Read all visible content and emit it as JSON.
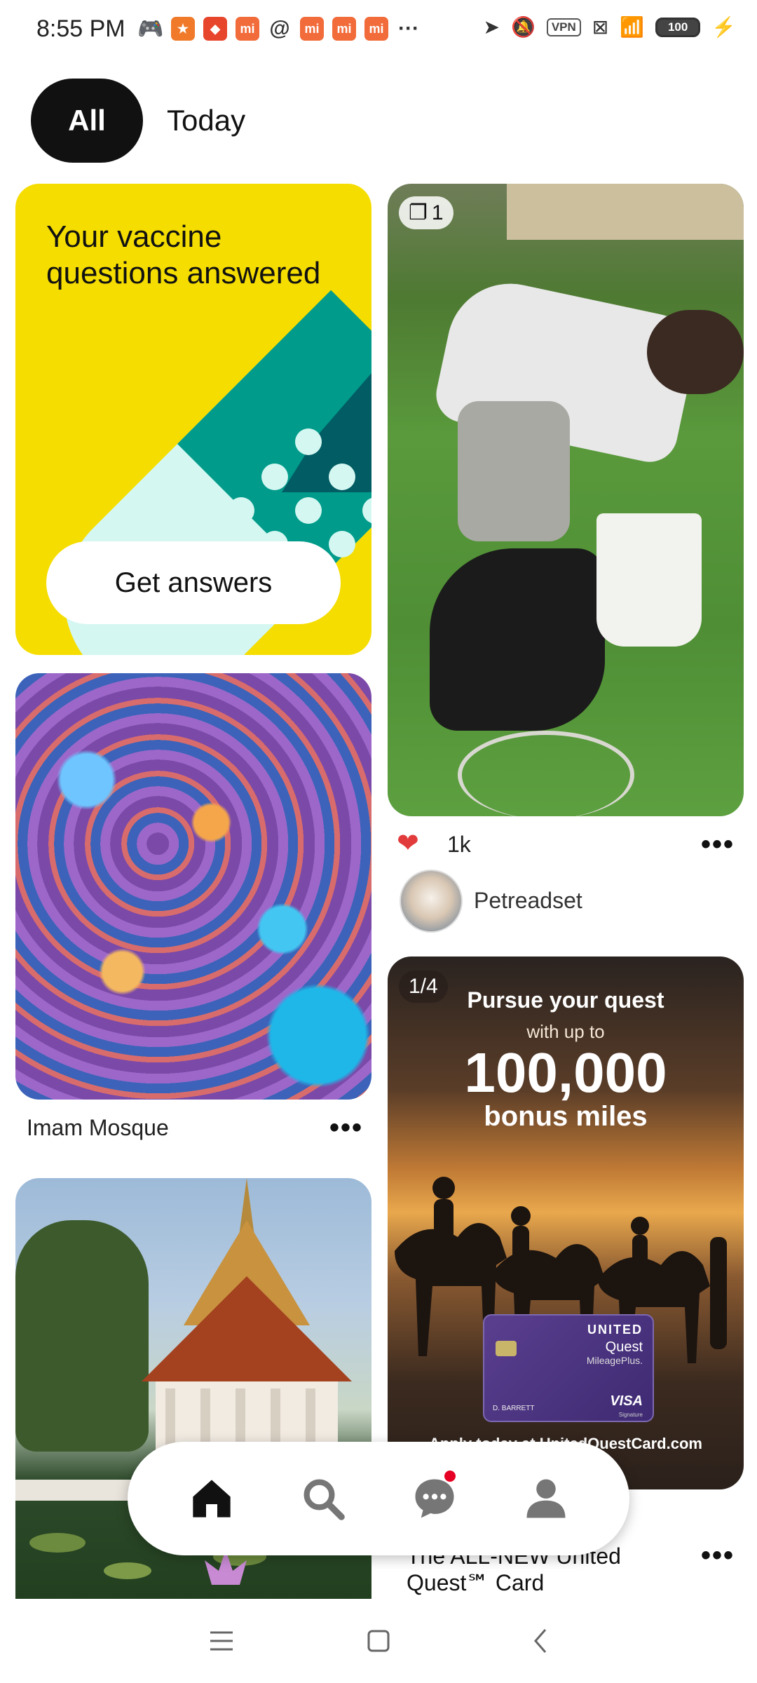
{
  "status_bar": {
    "time": "8:55 PM",
    "vpn_label": "VPN",
    "battery": "100"
  },
  "tabs": {
    "all": "All",
    "today": "Today"
  },
  "vaccine_card": {
    "title": "Your vaccine questions answered",
    "cta": "Get answers",
    "colors": {
      "background": "#f5dd00",
      "light": "#d4f7f1",
      "teal": "#009b8a",
      "dark_teal": "#015c63"
    }
  },
  "pins": {
    "mosque": {
      "title": "Imam Mosque"
    },
    "video": {
      "badge_count": "1",
      "likes": "1k",
      "user": "Petreadset"
    },
    "ad": {
      "badge": "1/4",
      "headline": "Pursue your quest",
      "subline": "with up to",
      "big_number": "100,000",
      "bonus": "bonus miles",
      "card_brand": "UNITED",
      "card_name": "Quest",
      "card_program": "MileagePlus.",
      "card_holder": "D. BARRETT",
      "card_network": "VISA",
      "card_sig": "Signature",
      "url_text": "Apply today at UnitedQuestCard.com",
      "title_line1": "The ALL-NEW United",
      "title_line2": "Quest℠ Card"
    },
    "more": "•••"
  },
  "nav": {
    "home": "home",
    "search": "search",
    "messages": "messages",
    "profile": "profile"
  },
  "accent_color": "#e60023"
}
